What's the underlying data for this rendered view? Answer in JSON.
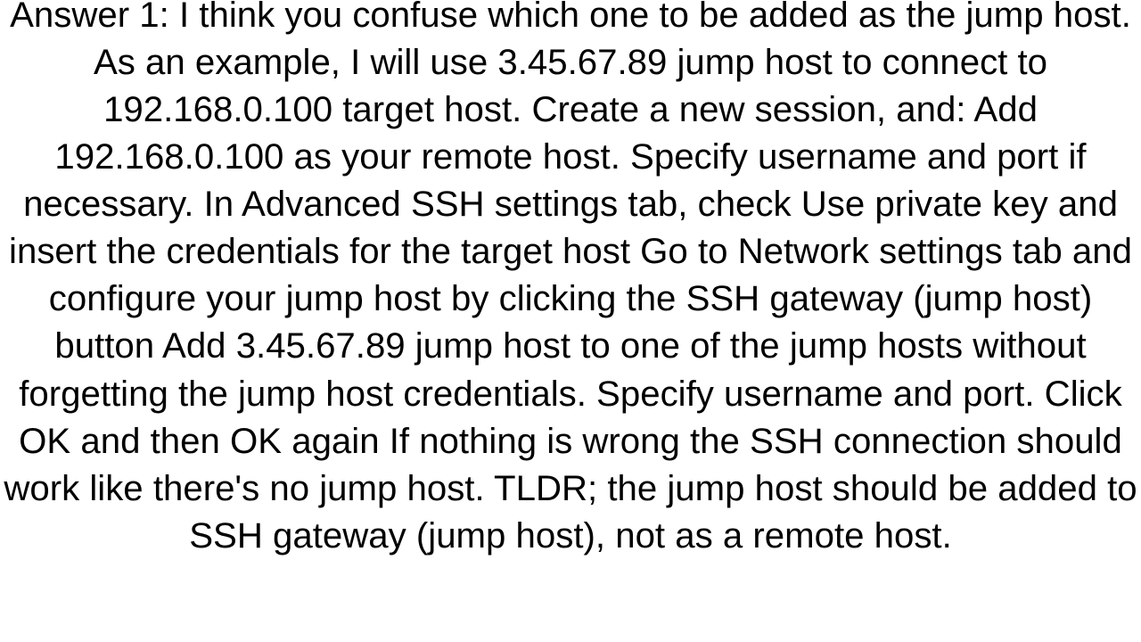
{
  "answer": {
    "text": "Answer 1: I think you confuse which one to be added as the jump host. As an example, I will use 3.45.67.89 jump host to connect to 192.168.0.100 target host. Create a new session, and:  Add 192.168.0.100 as your remote host. Specify username and port if necessary. In Advanced SSH settings tab, check Use private key and insert the credentials for the target host Go to Network settings tab and configure your jump host by clicking the SSH gateway (jump host) button Add 3.45.67.89 jump host to one of the jump hosts without forgetting the jump host credentials. Specify username and port. Click OK and then OK again  If nothing is wrong the SSH connection should work like there's no jump host. TLDR; the jump host should be added to SSH gateway (jump host), not as a remote host."
  }
}
